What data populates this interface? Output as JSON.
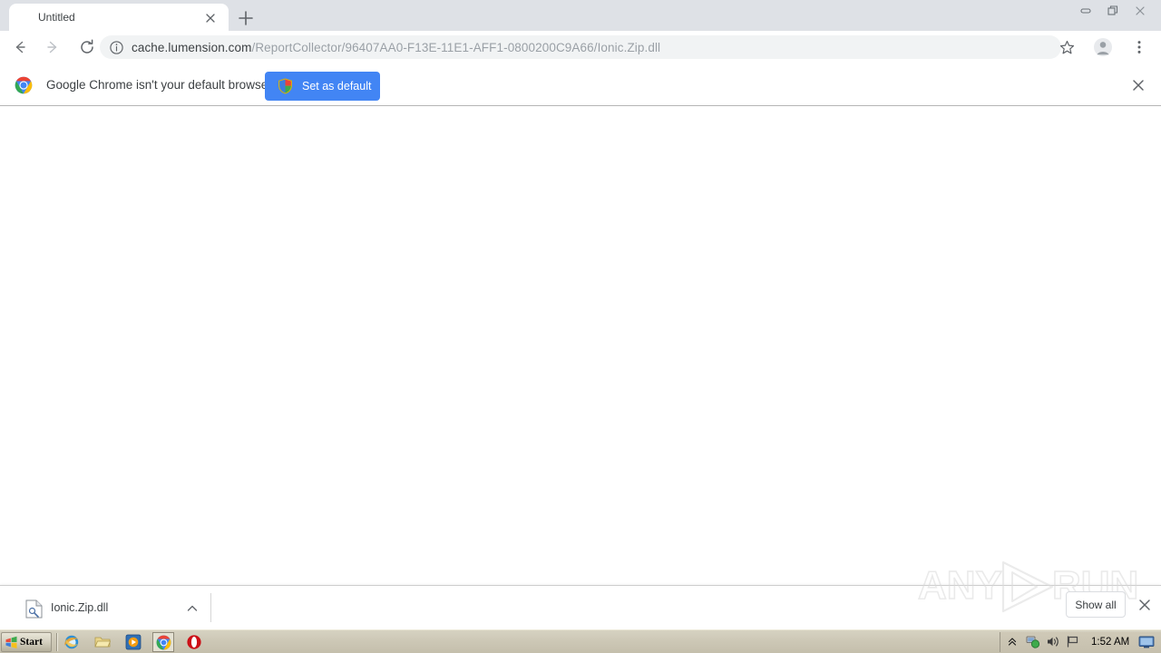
{
  "window": {
    "controls": [
      {
        "name": "minimize",
        "label": "—"
      },
      {
        "name": "restore",
        "label": "❐"
      },
      {
        "name": "close",
        "label": "✕"
      }
    ]
  },
  "tabstrip": {
    "tab_title": "Untitled",
    "tab_close_label": "✕",
    "new_tab_label": "+"
  },
  "toolbar": {
    "back_label": "←",
    "forward_label": "→",
    "reload_label": "⟳",
    "omnibox": {
      "security_icon": "info-circle-icon",
      "host": "cache.lumension.com",
      "path": "/ReportCollector/96407AA0-F13E-11E1-AFF1-0800200C9A66/Ionic.Zip.dll",
      "full_url": "cache.lumension.com/ReportCollector/96407AA0-F13E-11E1-AFF1-0800200C9A66/Ionic.Zip.dll"
    },
    "bookmark_label": "☆",
    "profile_label": "profile-avatar-icon",
    "menu_label": "⋮"
  },
  "infobar": {
    "message": "Google Chrome isn't your default browser",
    "button_label": "Set as default",
    "close_label": "✕",
    "button_color": "#4285f4"
  },
  "page": {
    "content": ""
  },
  "watermark": {
    "text_left": "ANY",
    "text_right": "RUN"
  },
  "download_shelf": {
    "item_name": "Ionic.Zip.dll",
    "item_menu_label": "⌃",
    "show_all_label": "Show all",
    "close_label": "✕"
  },
  "taskbar": {
    "start_label": "Start",
    "quick_launch": [
      {
        "name": "internet-explorer-icon",
        "active": false
      },
      {
        "name": "windows-explorer-icon",
        "active": false
      },
      {
        "name": "media-player-icon",
        "active": false
      },
      {
        "name": "google-chrome-icon",
        "active": true
      },
      {
        "name": "opera-icon",
        "active": false
      }
    ],
    "tray": {
      "chevron_label": "≫",
      "network_icon": "network-icon",
      "volume_icon": "volume-icon",
      "flag_icon": "flag-icon",
      "time": "1:52 AM",
      "monitor_icon": "monitor-icon"
    }
  }
}
